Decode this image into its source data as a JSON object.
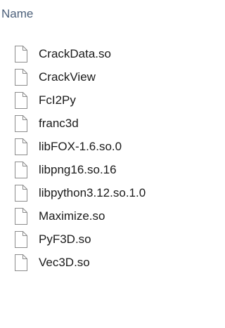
{
  "list": {
    "column_header": "Name",
    "icon": "blank-file-icon",
    "files": [
      {
        "name": "CrackData.so"
      },
      {
        "name": "CrackView"
      },
      {
        "name": "FcI2Py"
      },
      {
        "name": "franc3d"
      },
      {
        "name": "libFOX-1.6.so.0"
      },
      {
        "name": "libpng16.so.16"
      },
      {
        "name": "libpython3.12.so.1.0"
      },
      {
        "name": "Maximize.so"
      },
      {
        "name": "PyF3D.so"
      },
      {
        "name": "Vec3D.so"
      }
    ]
  }
}
